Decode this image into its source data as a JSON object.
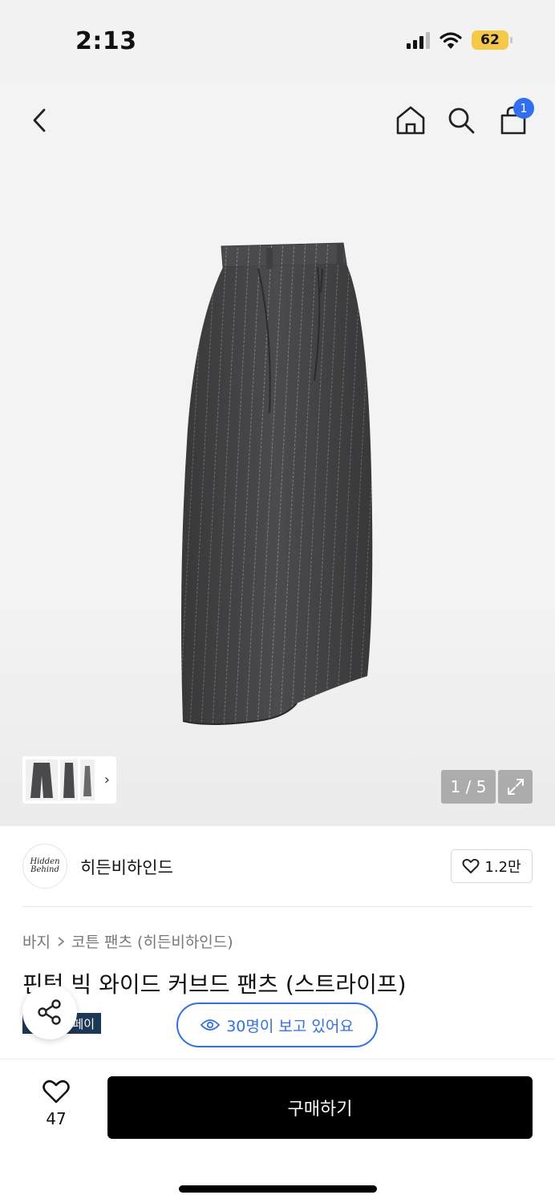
{
  "status_bar": {
    "time": "2:13",
    "battery": "62"
  },
  "nav": {
    "cart_count": "1"
  },
  "gallery": {
    "page_counter": "1 / 5"
  },
  "brand": {
    "logo_line1": "Hidden",
    "logo_line2": "Behind",
    "name": "히든비하인드",
    "likes": "1.2만"
  },
  "breadcrumb": {
    "category": "바지",
    "subcategory": "코튼 팬츠 (히든비하인드)"
  },
  "product": {
    "title": "핀턱 빅 와이드 커브드 팬츠 (스트라이프)",
    "tag": "페이"
  },
  "viewers": {
    "label": "30명이 보고 있어요"
  },
  "bottom": {
    "wish_count": "47",
    "buy_label": "구매하기"
  },
  "colors": {
    "accent": "#2f6ff5",
    "tag_bg": "#1c3757",
    "buy_bg": "#000000"
  },
  "icons": [
    "back-icon",
    "home-icon",
    "search-icon",
    "shopping-bag-icon",
    "chevron-right-icon",
    "expand-icon",
    "heart-icon",
    "share-icon",
    "eye-icon"
  ]
}
